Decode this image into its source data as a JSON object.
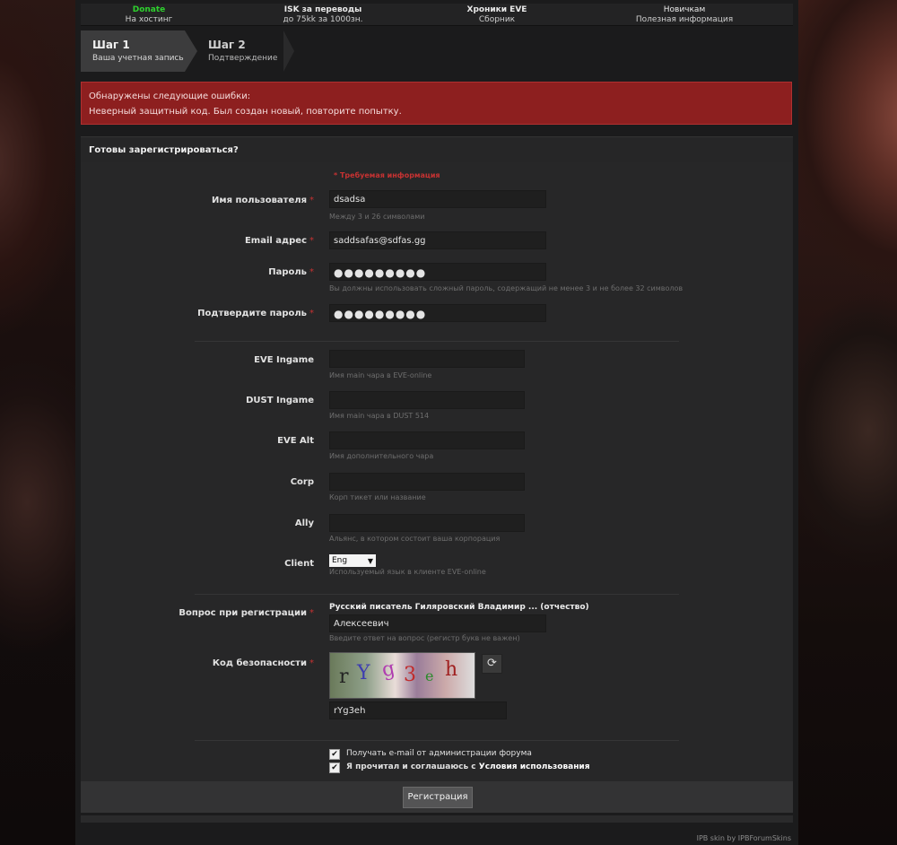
{
  "nav": [
    {
      "title": "Donate",
      "sub": "На хостинг",
      "color": "#2ed12e"
    },
    {
      "title": "ISK за переводы",
      "sub": "до 75kk за 1000зн."
    },
    {
      "title": "Хроники EVE",
      "sub": "Сборник"
    },
    {
      "title": "Новичкам",
      "sub": "Полезная информация"
    }
  ],
  "steps": [
    {
      "title": "Шаг 1",
      "sub": "Ваша учетная запись"
    },
    {
      "title": "Шаг 2",
      "sub": "Подтверждение"
    }
  ],
  "error": {
    "line1": "Обнаружены следующие ошибки:",
    "line2": "Неверный защитный код. Был создан новый, повторите попытку.",
    "color": "#8d1f1f"
  },
  "section_title": "Готовы зарегистрироваться?",
  "required_note": "* Требуемая информация",
  "fields": {
    "username": {
      "label": "Имя пользователя",
      "value": "dsadsa",
      "hint": "Между 3 и 26 символами"
    },
    "email": {
      "label": "Email адрес",
      "value": "saddsafas@sdfas.gg"
    },
    "password": {
      "label": "Пароль",
      "value": "●●●●●●●●●",
      "hint": "Вы должны использовать сложный пароль, содержащий не менее 3 и не более 32 символов"
    },
    "password_confirm": {
      "label": "Подтвердите пароль",
      "value": "●●●●●●●●●"
    },
    "eve_ingame": {
      "label": "EVE Ingame",
      "hint": "Имя main чара в EVE-online"
    },
    "dust_ingame": {
      "label": "DUST Ingame",
      "hint": "Имя main чара в DUST 514"
    },
    "eve_alt": {
      "label": "EVE Alt",
      "hint": "Имя дополнительного чара"
    },
    "corp": {
      "label": "Corp",
      "hint": "Корп тикет или название"
    },
    "ally": {
      "label": "Ally",
      "hint": "Альянс, в котором состоит ваша корпорация"
    },
    "client": {
      "label": "Client",
      "selected": "Eng",
      "hint": "Используемый язык в клиенте EVE-online"
    },
    "question": {
      "label": "Вопрос при регистрации",
      "question": "Русский писатель Гиляровский Владимир ... (отчество)",
      "value": "Алексеевич",
      "hint": "Введите ответ на вопрос (регистр букв не важен)"
    },
    "captcha": {
      "label": "Код безопасности",
      "image_text": "rYg3eh",
      "value": "rYg3eh"
    }
  },
  "checkboxes": {
    "admin_mail": {
      "label": "Получать e-mail от администрации форума",
      "checked": true
    },
    "terms": {
      "label_prefix": "Я прочитал и соглашаюсь с",
      "label_link": "Условия использования",
      "checked": true
    }
  },
  "submit_label": "Регистрация",
  "credits": "IPB skin by IPBForumSkins",
  "icons": {
    "refresh": "refresh-icon",
    "check": "check-icon",
    "caret": "caret-down-icon"
  }
}
